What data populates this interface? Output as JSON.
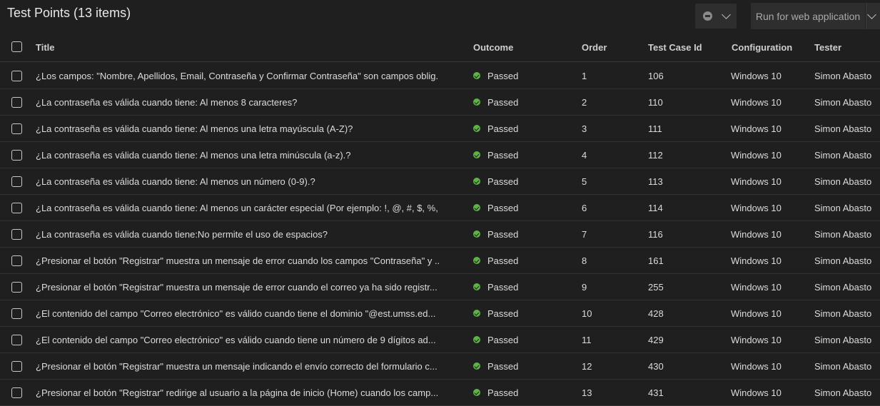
{
  "header": {
    "title": "Test Points (13 items)",
    "run_button_label": "Run for web application"
  },
  "columns": {
    "title": "Title",
    "outcome": "Outcome",
    "order": "Order",
    "test_case_id": "Test Case Id",
    "configuration": "Configuration",
    "tester": "Tester"
  },
  "colors": {
    "passed": "#5fb346",
    "background": "#1f1f1f"
  },
  "rows": [
    {
      "title": "¿Los campos: \"Nombre, Apellidos, Email, Contraseña y Confirmar Contraseña\" son campos oblig...",
      "outcome": "Passed",
      "order": "1",
      "test_case_id": "106",
      "configuration": "Windows 10",
      "tester": "Simon Abasto"
    },
    {
      "title": "¿La contraseña es válida cuando tiene: Al menos 8 caracteres?",
      "outcome": "Passed",
      "order": "2",
      "test_case_id": "110",
      "configuration": "Windows 10",
      "tester": "Simon Abasto"
    },
    {
      "title": "¿La contraseña es válida cuando tiene: Al menos una letra mayúscula (A-Z)?",
      "outcome": "Passed",
      "order": "3",
      "test_case_id": "111",
      "configuration": "Windows 10",
      "tester": "Simon Abasto"
    },
    {
      "title": "¿La contraseña es válida cuando tiene: Al menos una letra minúscula (a-z).?",
      "outcome": "Passed",
      "order": "4",
      "test_case_id": "112",
      "configuration": "Windows 10",
      "tester": "Simon Abasto"
    },
    {
      "title": "¿La contraseña es válida cuando tiene: Al menos un número (0-9).?",
      "outcome": "Passed",
      "order": "5",
      "test_case_id": "113",
      "configuration": "Windows 10",
      "tester": "Simon Abasto"
    },
    {
      "title": "¿La contraseña es válida cuando tiene: Al menos un carácter especial (Por ejemplo: !, @, #, $, %, ...",
      "outcome": "Passed",
      "order": "6",
      "test_case_id": "114",
      "configuration": "Windows 10",
      "tester": "Simon Abasto"
    },
    {
      "title": "¿La contraseña es válida cuando tiene:No permite el uso de espacios?",
      "outcome": "Passed",
      "order": "7",
      "test_case_id": "116",
      "configuration": "Windows 10",
      "tester": "Simon Abasto"
    },
    {
      "title": "¿Presionar el botón \"Registrar\" muestra un mensaje de error cuando los campos \"Contraseña\" y ...",
      "outcome": "Passed",
      "order": "8",
      "test_case_id": "161",
      "configuration": "Windows 10",
      "tester": "Simon Abasto"
    },
    {
      "title": "¿Presionar el botón \"Registrar\" muestra un mensaje de error cuando el correo ya ha sido registr...",
      "outcome": "Passed",
      "order": "9",
      "test_case_id": "255",
      "configuration": "Windows 10",
      "tester": "Simon Abasto"
    },
    {
      "title": "¿El contenido del campo \"Correo electrónico\" es válido cuando tiene el dominio \"@est.umss.ed...",
      "outcome": "Passed",
      "order": "10",
      "test_case_id": "428",
      "configuration": "Windows 10",
      "tester": "Simon Abasto"
    },
    {
      "title": "¿El contenido del campo \"Correo electrónico\" es válido cuando tiene un número de 9 dígitos ad...",
      "outcome": "Passed",
      "order": "11",
      "test_case_id": "429",
      "configuration": "Windows 10",
      "tester": "Simon Abasto"
    },
    {
      "title": "¿Presionar el botón \"Registrar\" muestra un mensaje indicando el envío correcto del formulario c...",
      "outcome": "Passed",
      "order": "12",
      "test_case_id": "430",
      "configuration": "Windows 10",
      "tester": "Simon Abasto"
    },
    {
      "title": "¿Presionar el botón \"Registrar\" redirige al usuario a la página de inicio (Home) cuando los camp...",
      "outcome": "Passed",
      "order": "13",
      "test_case_id": "431",
      "configuration": "Windows 10",
      "tester": "Simon Abasto"
    }
  ]
}
